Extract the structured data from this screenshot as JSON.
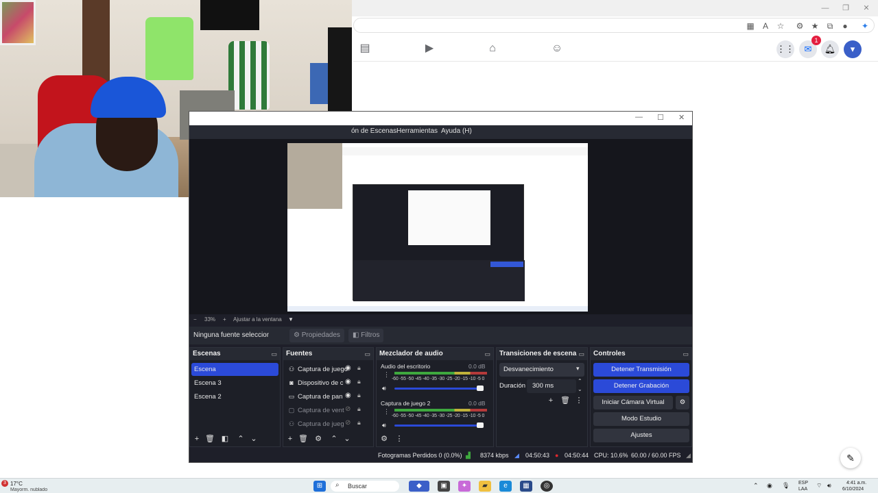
{
  "obs": {
    "menu": [
      "ón de Escenas",
      "Herramientas",
      "Ayuda (H)"
    ],
    "zoom": {
      "minus": "−",
      "percent": "33%",
      "plus": "+",
      "fit": "Ajustar a la ventana",
      "arrow": "▼"
    },
    "source_bar": {
      "no_source": "Ninguna fuente seleccionad",
      "properties": "Propiedades",
      "filters": "Filtros"
    },
    "scenes": {
      "title": "Escenas",
      "items": [
        "Escena",
        "Escena 3",
        "Escena 2"
      ]
    },
    "sources": {
      "title": "Fuentes",
      "items": [
        "Captura de juego",
        "Dispositivo de c",
        "Captura de pan",
        "Captura de vent",
        "Captura de jueg"
      ]
    },
    "mixer": {
      "title": "Mezclador de audio",
      "channels": [
        {
          "name": "Audio del escritorio",
          "db": "0.0 dB",
          "scale": "-60 -55 -50 -45 -40 -35 -30 -25 -20 -15 -10 -5 0",
          "level": 1.0
        },
        {
          "name": "Captura de juego 2",
          "db": "0.0 dB",
          "scale": "-60 -55 -50 -45 -40 -35 -30 -25 -20 -15 -10 -5 0",
          "level": 1.0
        }
      ]
    },
    "transitions": {
      "title": "Transiciones de escena",
      "selected": "Desvanecimiento",
      "duration_label": "Duración",
      "duration_value": "300 ms"
    },
    "controls": {
      "title": "Controles",
      "stop_stream": "Detener Transmisión",
      "stop_record": "Detener Grabación",
      "virtual_cam": "Iniciar Cámara Virtual",
      "studio_mode": "Modo Estudio",
      "settings": "Ajustes"
    },
    "status": {
      "dropped": "Fotogramas Perdidos 0 (0.0%)",
      "kbps": "8374 kbps",
      "stream_time": "04:50:43",
      "rec_time": "04:50:44",
      "cpu": "CPU: 10.6%",
      "fps": "60.00 / 60.00 FPS"
    }
  },
  "browser": {
    "messenger_badge": "1"
  },
  "taskbar": {
    "weather_temp": "17°C",
    "weather_desc": "Mayorm. nublado",
    "weather_badge": "3",
    "search": "Buscar",
    "lang": "ESP",
    "lang2": "LAA",
    "time": "4:41 a.m.",
    "date": "6/10/2024"
  },
  "colors": {
    "obs_bg": "#1e1f29",
    "obs_accent": "#2b4ad8",
    "rec_red": "#e0282e"
  }
}
